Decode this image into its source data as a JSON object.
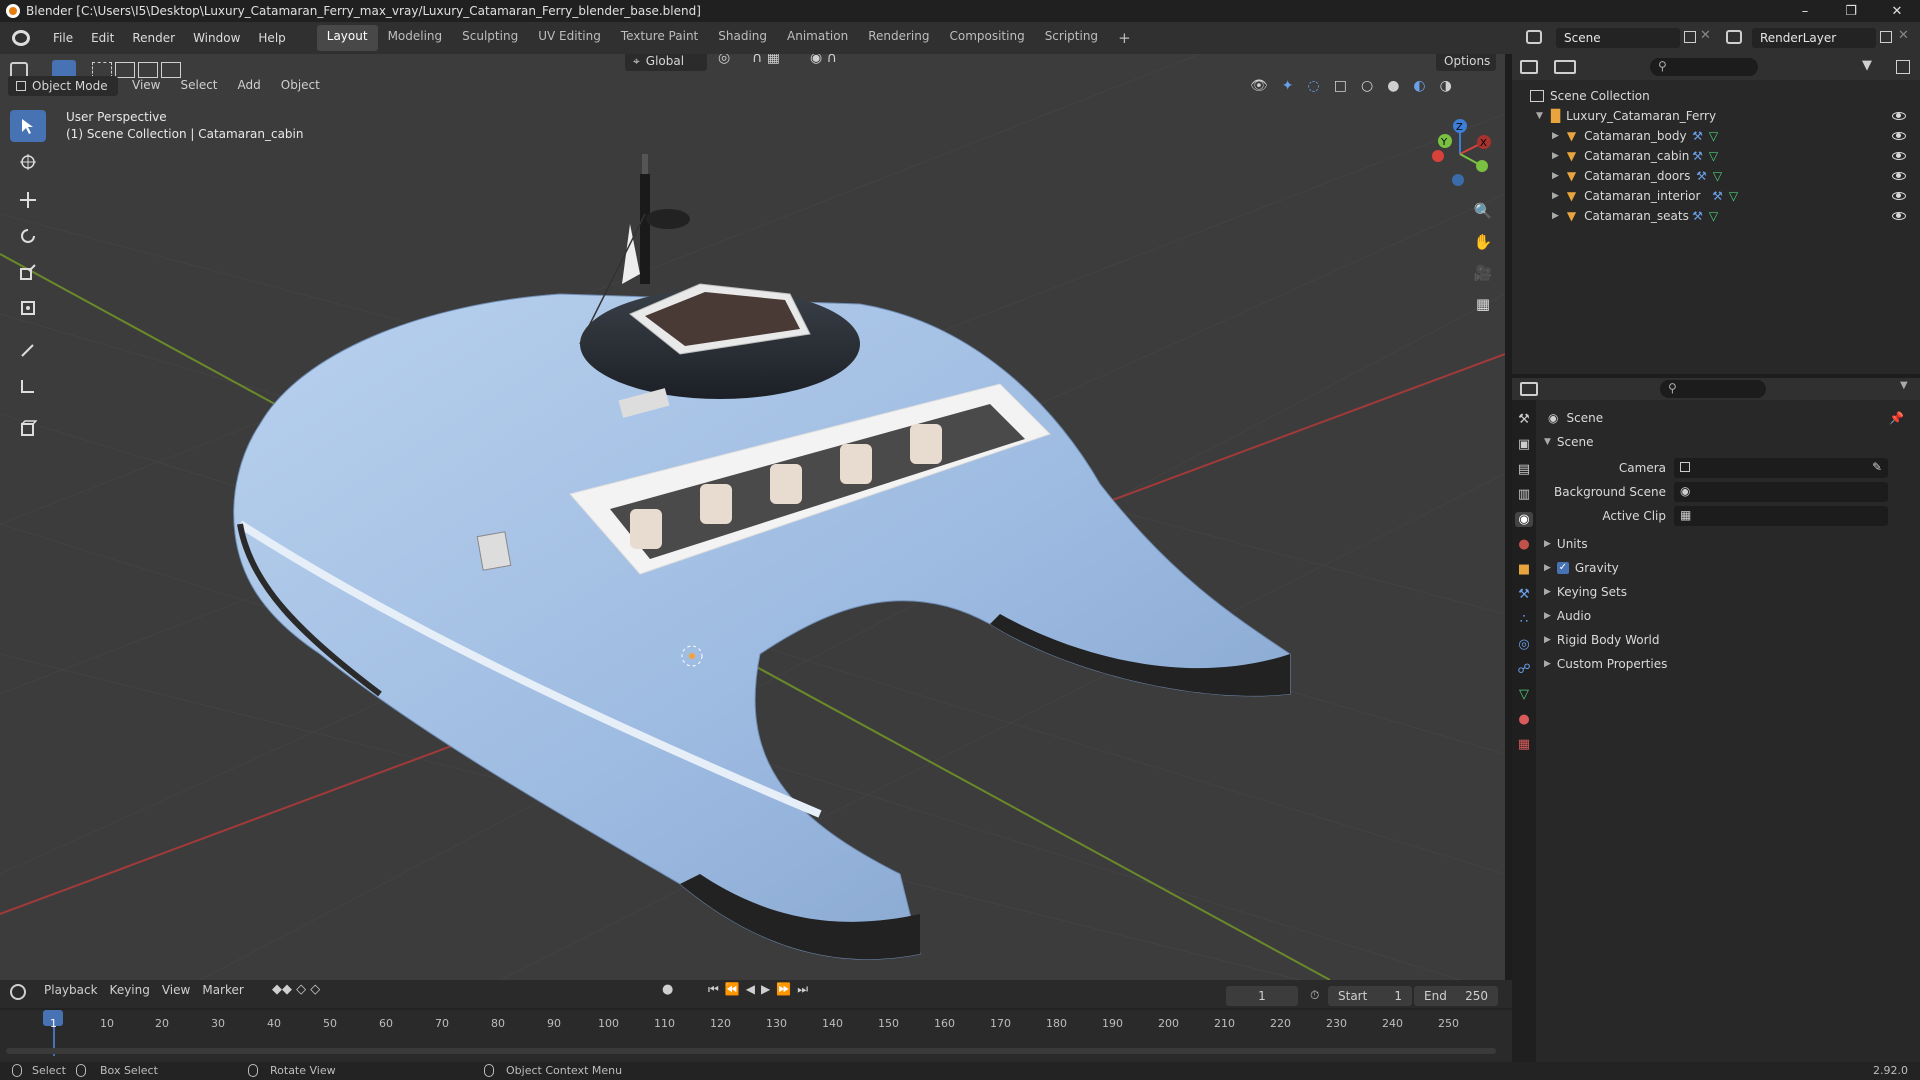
{
  "window": {
    "title": "Blender [C:\\Users\\I5\\Desktop\\Luxury_Catamaran_Ferry_max_vray/Luxury_Catamaran_Ferry_blender_base.blend]"
  },
  "menu": [
    "File",
    "Edit",
    "Render",
    "Window",
    "Help"
  ],
  "workspaces": [
    {
      "label": "Layout",
      "active": true
    },
    {
      "label": "Modeling"
    },
    {
      "label": "Sculpting"
    },
    {
      "label": "UV Editing"
    },
    {
      "label": "Texture Paint"
    },
    {
      "label": "Shading"
    },
    {
      "label": "Animation"
    },
    {
      "label": "Rendering"
    },
    {
      "label": "Compositing"
    },
    {
      "label": "Scripting"
    }
  ],
  "topbar": {
    "scene": "Scene",
    "view_layer": "RenderLayer"
  },
  "viewport": {
    "mode": "Object Mode",
    "menus": [
      "View",
      "Select",
      "Add",
      "Object"
    ],
    "orientation": "Global",
    "options": "Options",
    "overlay_line1": "User Perspective",
    "overlay_line2": "(1) Scene Collection | Catamaran_cabin",
    "gizmo": {
      "x": "X",
      "y": "Y",
      "z": "Z"
    }
  },
  "outliner": {
    "root": "Scene Collection",
    "collection": "Luxury_Catamaran_Ferry",
    "items": [
      "Catamaran_body",
      "Catamaran_cabin",
      "Catamaran_doors",
      "Catamaran_interior",
      "Catamaran_seats"
    ]
  },
  "properties": {
    "context": "Scene",
    "panel": "Scene",
    "fields": [
      {
        "label": "Camera"
      },
      {
        "label": "Background Scene"
      },
      {
        "label": "Active Clip"
      }
    ],
    "sections": [
      "Units",
      "Gravity",
      "Keying Sets",
      "Audio",
      "Rigid Body World",
      "Custom Properties"
    ],
    "gravity_checked": true
  },
  "timeline": {
    "menus": [
      "Playback",
      "Keying",
      "View",
      "Marker"
    ],
    "current_frame": "1",
    "start_label": "Start",
    "start": "1",
    "end_label": "End",
    "end": "250",
    "ticks": [
      "1",
      "10",
      "20",
      "30",
      "40",
      "50",
      "60",
      "70",
      "80",
      "90",
      "100",
      "110",
      "120",
      "130",
      "140",
      "150",
      "160",
      "170",
      "180",
      "190",
      "200",
      "210",
      "220",
      "230",
      "240",
      "250"
    ]
  },
  "status": {
    "select": "Select",
    "box_select": "Box Select",
    "rotate": "Rotate View",
    "context_menu": "Object Context Menu",
    "version": "2.92.0"
  },
  "colors": {
    "accent": "#4772b3",
    "hull": "#a8c4e6",
    "viewport": "#3c3c3c",
    "panel": "#282828"
  }
}
